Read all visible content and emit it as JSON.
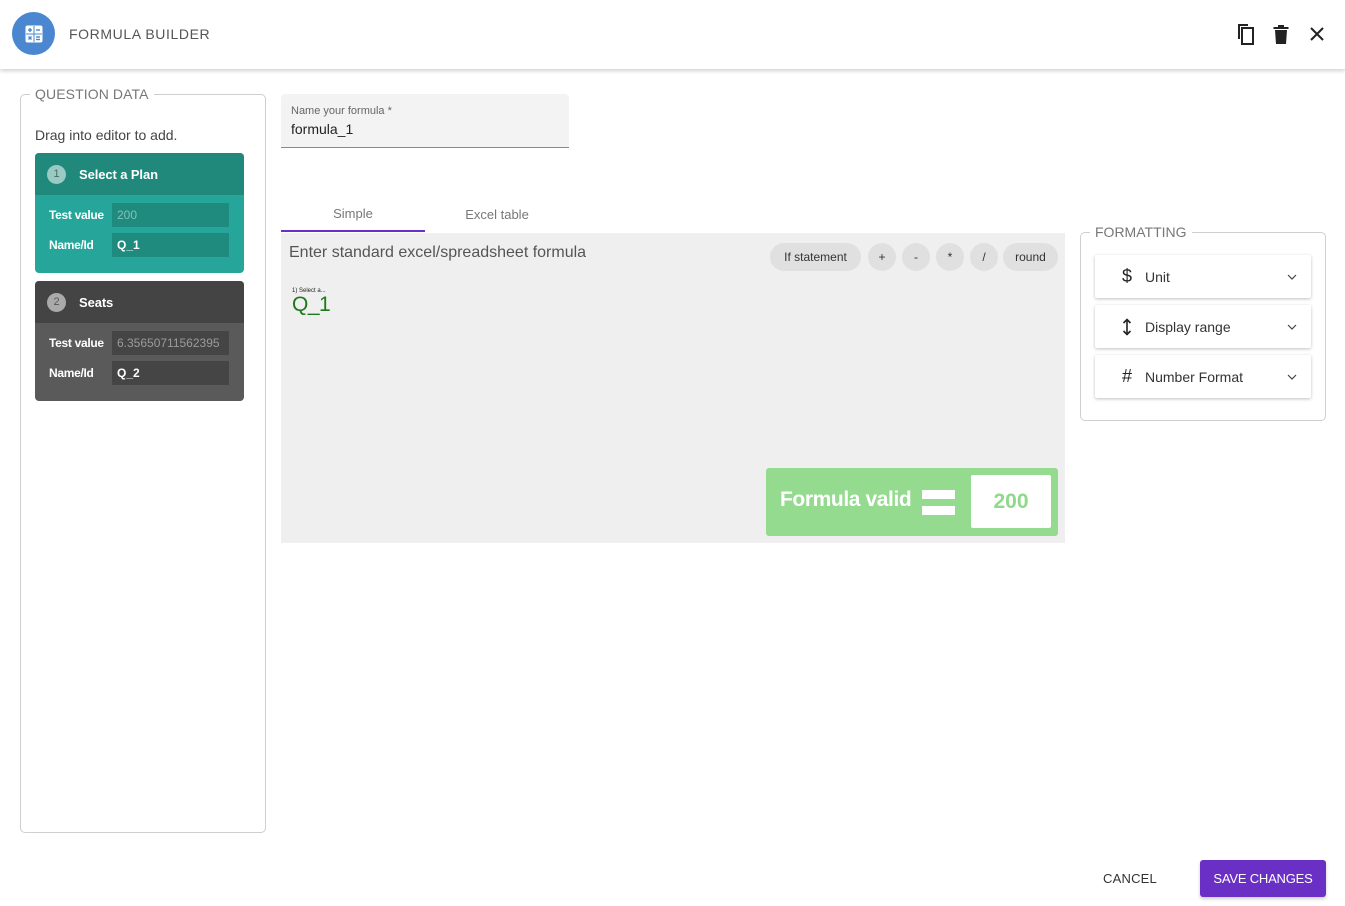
{
  "header": {
    "title": "FORMULA BUILDER",
    "app_icon": "calculator-icon",
    "actions": [
      "copy-icon",
      "trash-icon",
      "close-icon"
    ]
  },
  "question_data": {
    "legend": "QUESTION DATA",
    "hint": "Drag into editor to add.",
    "cards": [
      {
        "number": "1",
        "title": "Select a Plan",
        "test_label": "Test value",
        "test_value": "200",
        "name_label": "Name/Id",
        "name_value": "Q_1",
        "color": "#26a69a"
      },
      {
        "number": "2",
        "title": "Seats",
        "test_label": "Test value",
        "test_value": "6.35650711562395",
        "name_label": "Name/Id",
        "name_value": "Q_2",
        "color": "#5a5a5a"
      }
    ]
  },
  "formula_name": {
    "label": "Name your formula *",
    "value": "formula_1"
  },
  "tabs": [
    {
      "label": "Simple",
      "active": true
    },
    {
      "label": "Excel table",
      "active": false
    }
  ],
  "editor": {
    "placeholder": "Enter standard excel/spreadsheet formula",
    "chips": [
      "If statement",
      "+",
      "-",
      "*",
      "/",
      "round"
    ],
    "token": {
      "caption": "1) Select a...",
      "value": "Q_1"
    },
    "status_text": "Formula valid",
    "result": "200",
    "status_color": "#94db8f"
  },
  "formatting": {
    "legend": "FORMATTING",
    "items": [
      {
        "icon": "dollar-icon",
        "label": "Unit"
      },
      {
        "icon": "vertical-arrows-icon",
        "label": "Display range"
      },
      {
        "icon": "hash-icon",
        "label": "Number Format"
      }
    ]
  },
  "footer": {
    "cancel_label": "CANCEL",
    "save_label": "SAVE CHANGES",
    "accent": "#6a2fc4"
  }
}
